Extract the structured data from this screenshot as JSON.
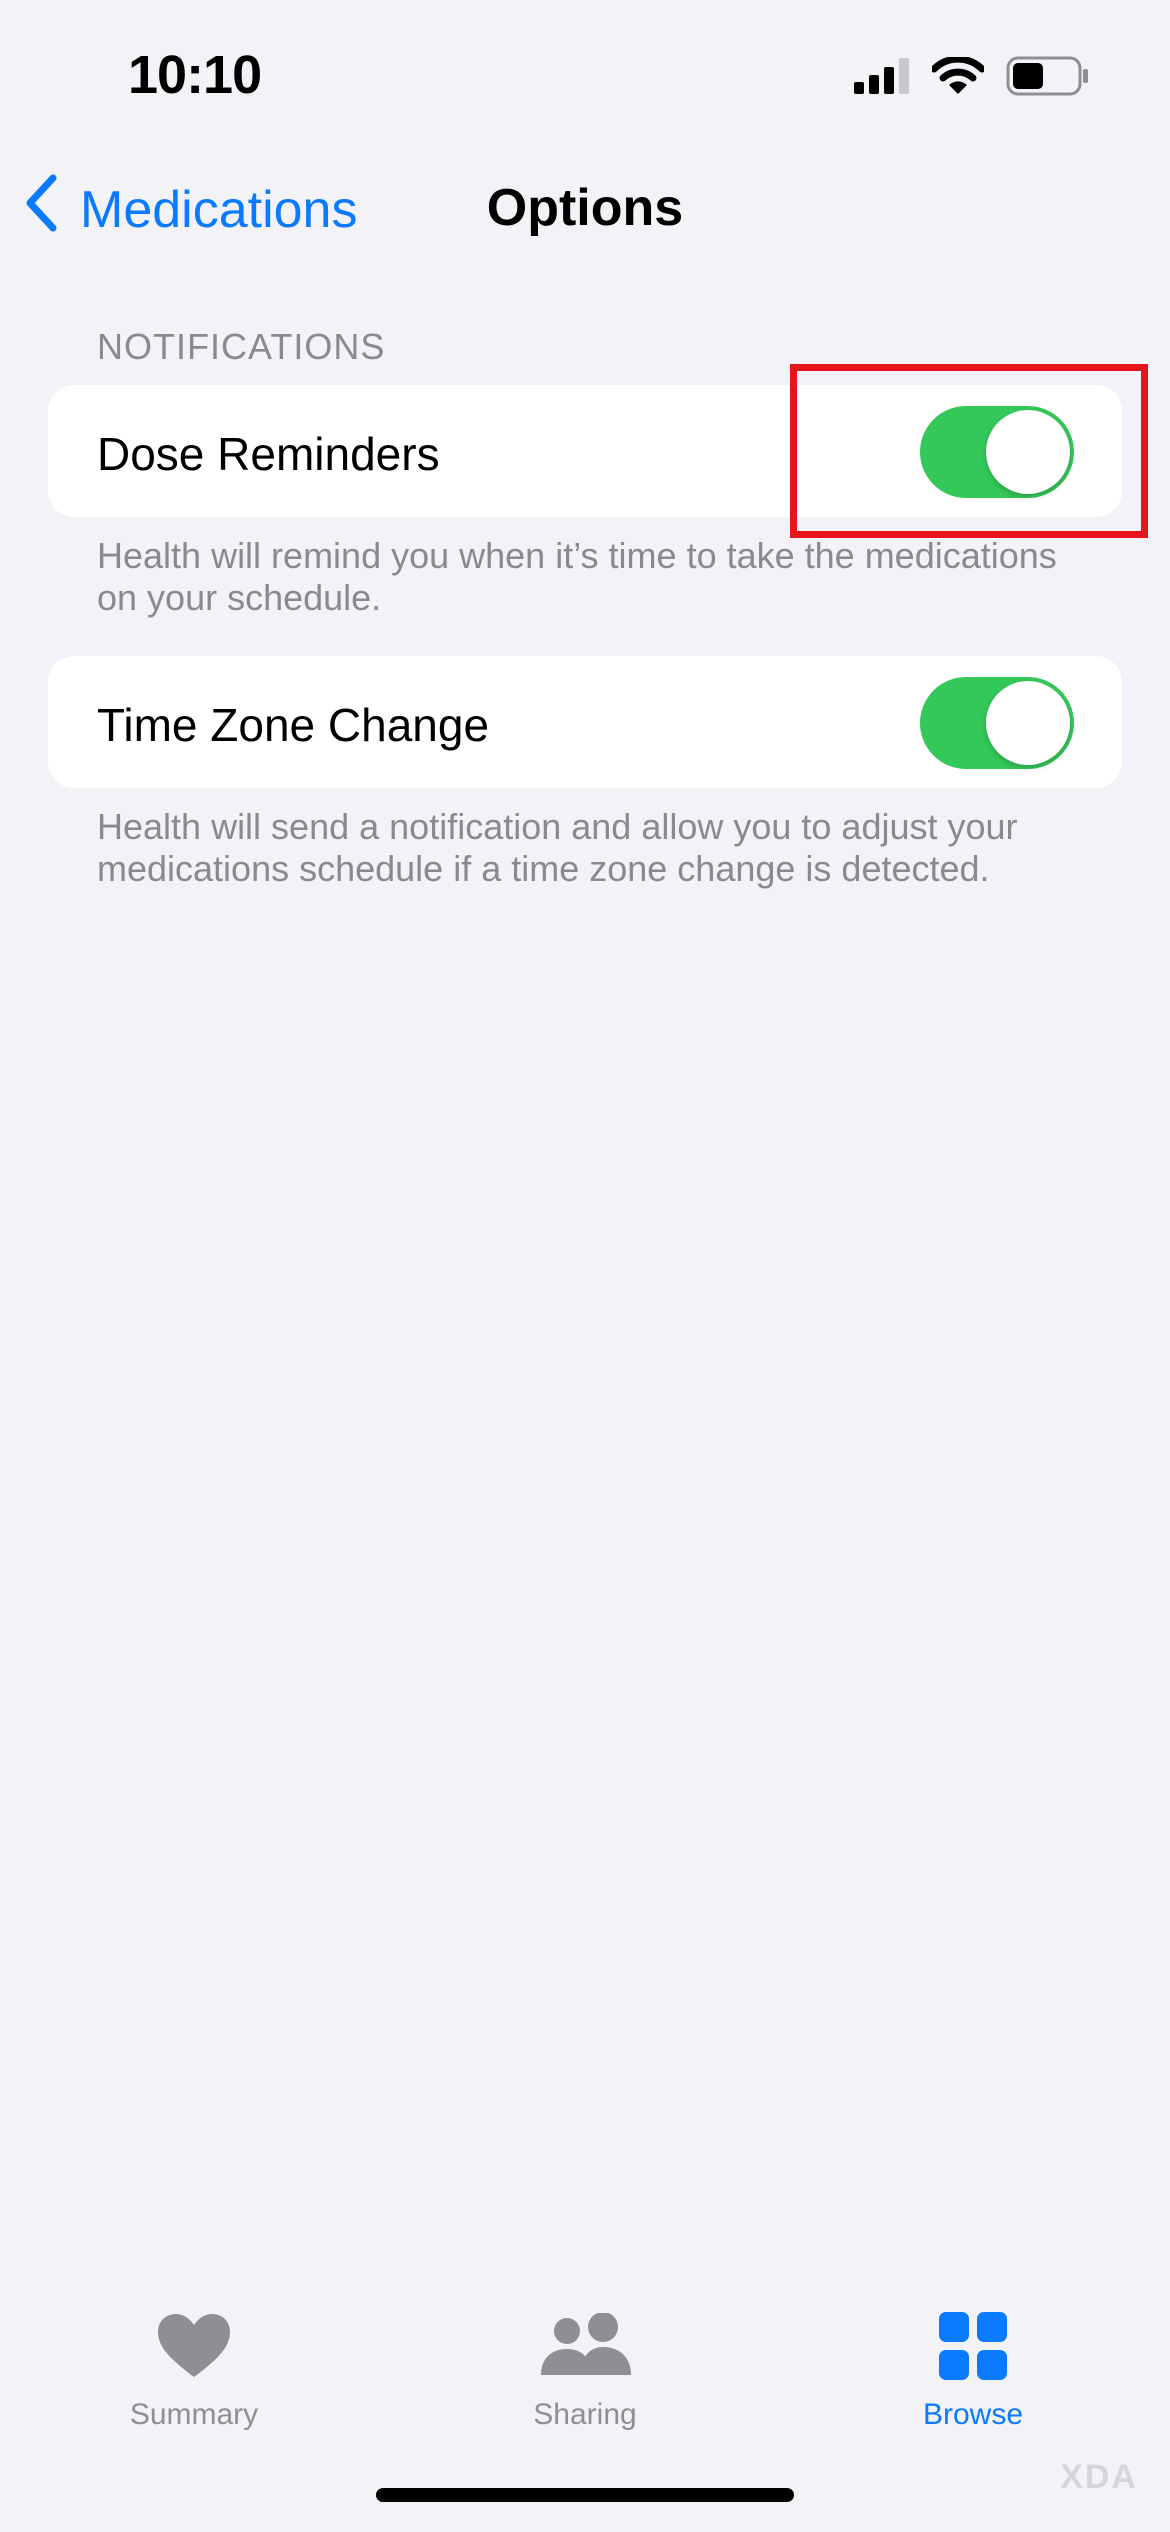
{
  "status_bar": {
    "time": "10:10",
    "icons": [
      "cellular-signal-icon",
      "wifi-icon",
      "battery-icon"
    ]
  },
  "nav": {
    "back_label": "Medications",
    "title": "Options"
  },
  "notifications_section": {
    "header": "NOTIFICATIONS",
    "items": [
      {
        "label": "Dose Reminders",
        "enabled": true,
        "footer": "Health will remind you when it’s time to take the medications on your schedule."
      },
      {
        "label": "Time Zone Change",
        "enabled": true,
        "footer": "Health will send a notification and allow you to adjust your medications schedule if a time zone change is detected."
      }
    ]
  },
  "tab_bar": {
    "tabs": [
      {
        "label": "Summary",
        "icon": "heart-icon",
        "active": false
      },
      {
        "label": "Sharing",
        "icon": "people-icon",
        "active": false
      },
      {
        "label": "Browse",
        "icon": "grid-icon",
        "active": true
      }
    ]
  },
  "watermark": "XDA",
  "colors": {
    "accent": "#0A7AFF",
    "toggle_on": "#34C759",
    "background": "#F2F2F7",
    "highlight": "#E8141B"
  }
}
